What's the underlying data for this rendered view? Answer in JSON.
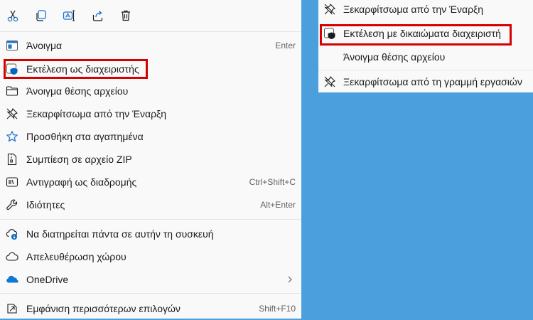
{
  "toolbar": {
    "icons": [
      "cut-icon",
      "copy-icon",
      "rename-icon",
      "share-icon",
      "delete-icon"
    ]
  },
  "menu": {
    "items": [
      {
        "label": "Άνοιγμα",
        "shortcut": "Enter"
      },
      {
        "label": "Εκτέλεση ως διαχειριστής",
        "shortcut": ""
      },
      {
        "label": "Άνοιγμα θέσης αρχείου",
        "shortcut": ""
      },
      {
        "label": "Ξεκαρφίτσωμα από την Έναρξη",
        "shortcut": ""
      },
      {
        "label": "Προσθήκη στα αγαπημένα",
        "shortcut": ""
      },
      {
        "label": "Συμπίεση σε αρχείο ZIP",
        "shortcut": ""
      },
      {
        "label": "Αντιγραφή ως διαδρομής",
        "shortcut": "Ctrl+Shift+C"
      },
      {
        "label": "Ιδιότητες",
        "shortcut": "Alt+Enter"
      },
      {
        "label": "Να διατηρείται πάντα σε αυτήν τη συσκευή",
        "shortcut": ""
      },
      {
        "label": "Απελευθέρωση χώρου",
        "shortcut": ""
      },
      {
        "label": "OneDrive",
        "shortcut": ""
      },
      {
        "label": "Εμφάνιση περισσότερων επιλογών",
        "shortcut": "Shift+F10"
      }
    ]
  },
  "menu2": {
    "items": [
      {
        "label": "Ξεκαρφίτσωμα από την Έναρξη"
      },
      {
        "label": "Εκτέλεση με δικαιώματα διαχειριστή"
      },
      {
        "label": "Άνοιγμα θέσης αρχείου"
      },
      {
        "label": "Ξεκαρφίτσωμα από τη γραμμή εργασιών"
      }
    ]
  },
  "colors": {
    "desktop": "#4a9fdc",
    "menu_bg": "#f9f9f9",
    "highlight_box": "#d60000",
    "accent": "#0067c0"
  }
}
